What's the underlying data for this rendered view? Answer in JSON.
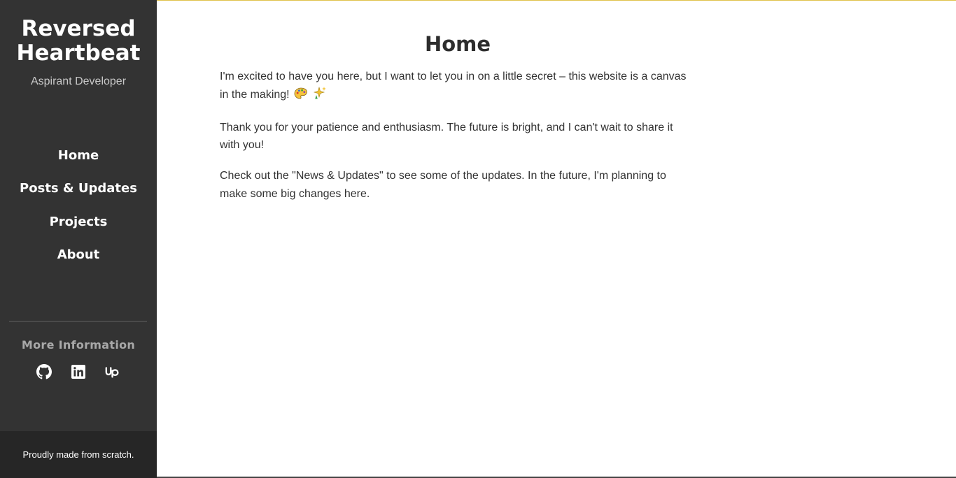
{
  "sidebar": {
    "title_line1": "Reversed",
    "title_line2": "Heartbeat",
    "subtitle": "Aspirant Developer",
    "nav": [
      {
        "label": "Home"
      },
      {
        "label": "Posts & Updates"
      },
      {
        "label": "Projects"
      },
      {
        "label": "About"
      }
    ],
    "more_info_heading": "More Information",
    "social": [
      {
        "icon": "github-icon"
      },
      {
        "icon": "linkedin-icon"
      },
      {
        "icon": "upwork-icon"
      }
    ],
    "footer_text": "Proudly made from scratch."
  },
  "main": {
    "title": "Home",
    "paragraphs": [
      "I'm excited to have you here, but I want to let you in on a little secret – this website is a canvas in the making!",
      "Thank you for your patience and enthusiasm. The future is bright, and I can't wait to share it with you!",
      "Check out the \"News & Updates\" to see some of the updates. In the future, I'm planning to make some big changes here."
    ],
    "paragraph1_emojis": [
      "palette-icon",
      "sparkles-icon"
    ]
  },
  "colors": {
    "sidebar_bg": "#333333",
    "footer_bg": "#262626",
    "accent_line": "#e0c24c",
    "text": "#333333"
  }
}
